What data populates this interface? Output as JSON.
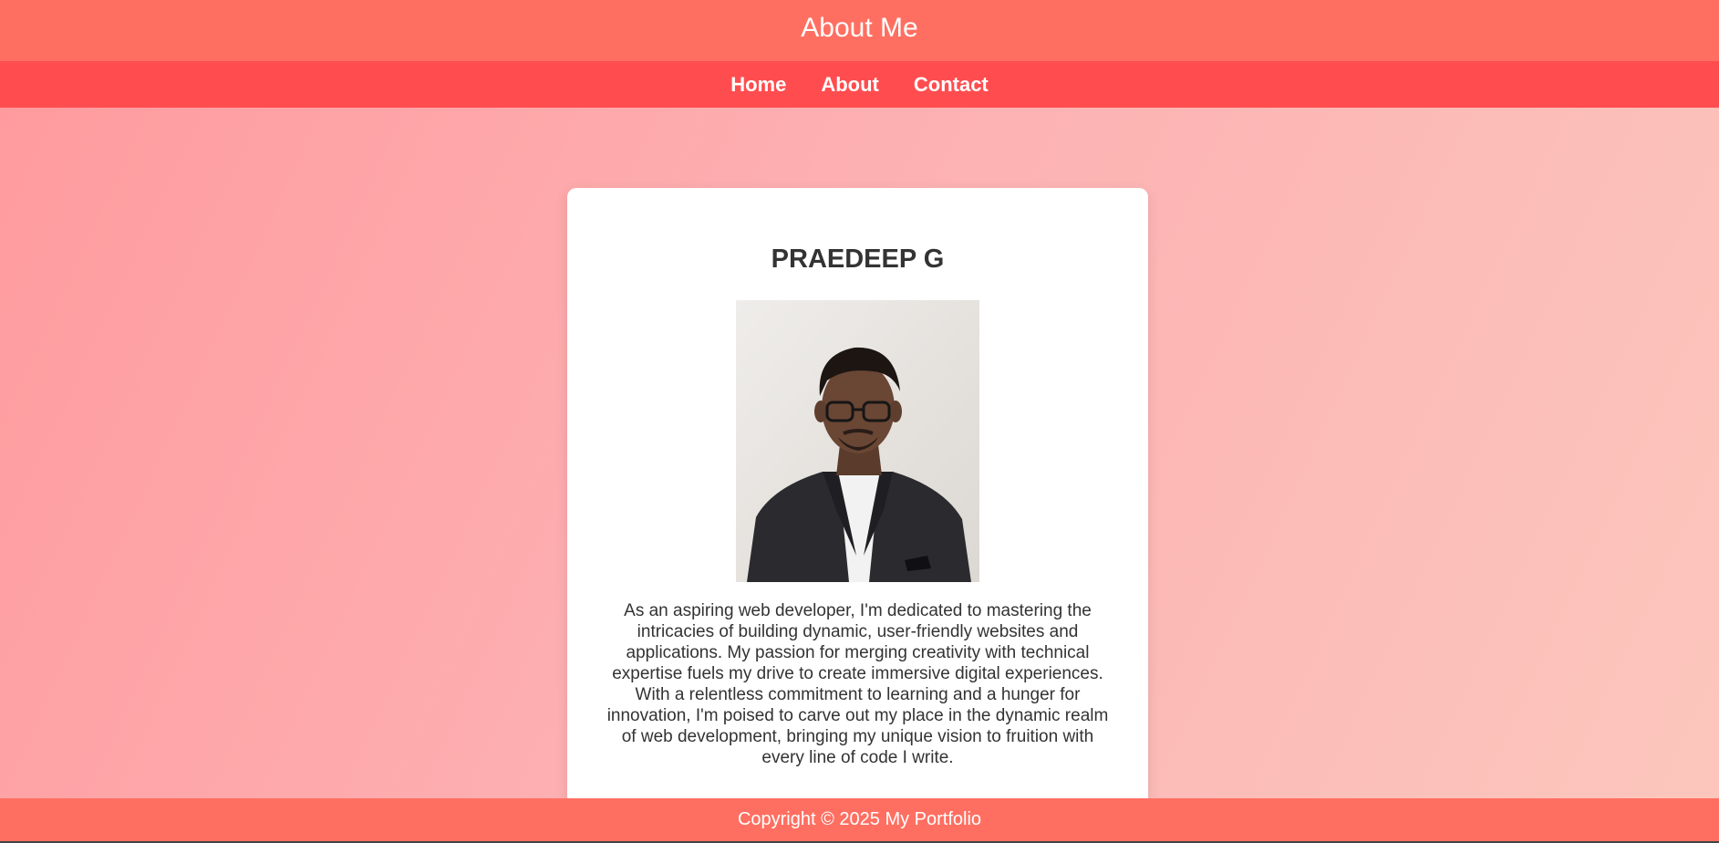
{
  "header": {
    "title": "About Me"
  },
  "nav": {
    "items": [
      {
        "label": "Home"
      },
      {
        "label": "About"
      },
      {
        "label": "Contact"
      }
    ]
  },
  "profile": {
    "name": "PRAEDEEP G",
    "photo_icon": "profile-photo",
    "bio": "As an aspiring web developer, I'm dedicated to mastering the intricacies of building dynamic, user-friendly websites and applications. My passion for merging creativity with technical expertise fuels my drive to create immersive digital experiences. With a relentless commitment to learning and a hunger for innovation, I'm poised to carve out my place in the dynamic realm of web development, bringing my unique vision to fruition with every line of code I write."
  },
  "footer": {
    "text": "Copyright © 2025 My Portfolio"
  },
  "colors": {
    "header_bg": "#ff6f61",
    "nav_bg": "#ff4d4f",
    "card_bg": "#ffffff",
    "text_dark": "#333333"
  }
}
